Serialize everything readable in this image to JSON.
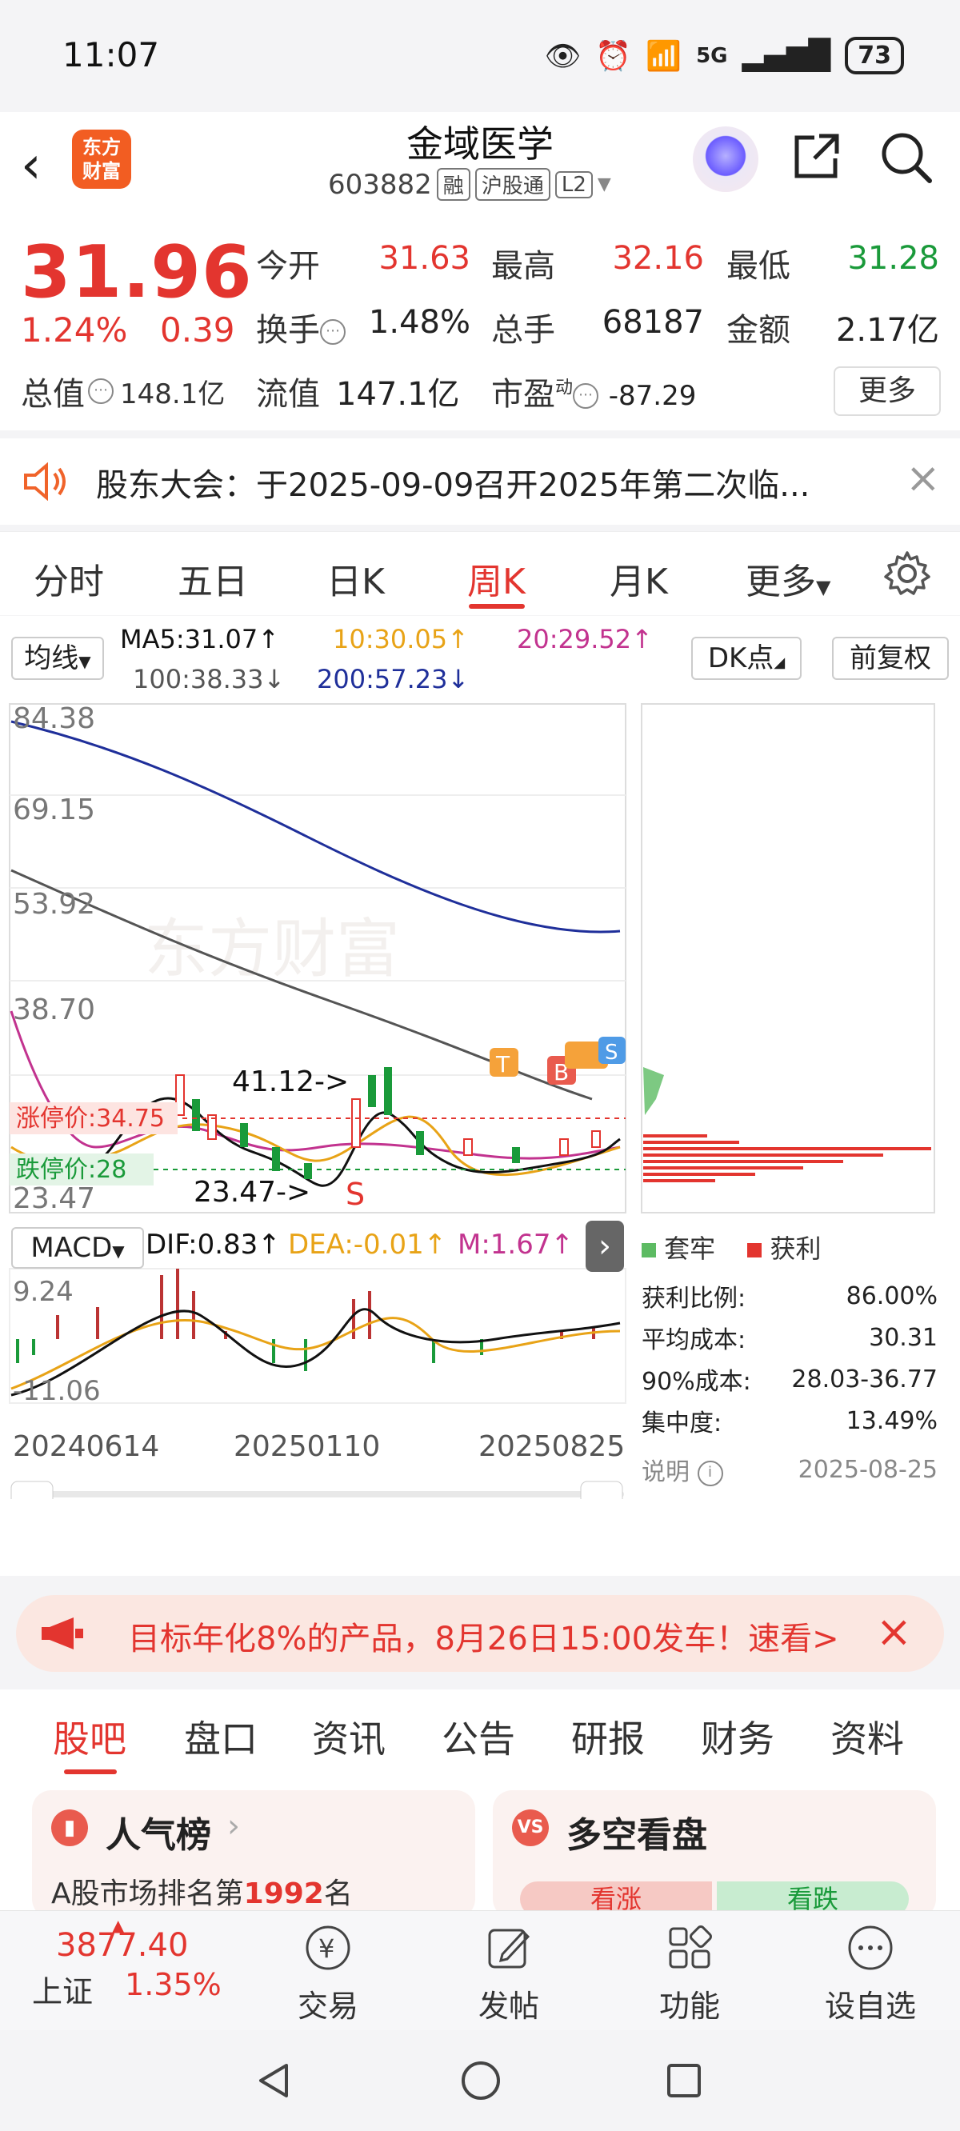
{
  "status": {
    "time": "11:07",
    "battery": "73",
    "network": "5G"
  },
  "header": {
    "logo_line1": "东方",
    "logo_line2": "财富",
    "stock_name": "金域医学",
    "stock_code": "603882",
    "tags": [
      "融",
      "沪股通",
      "L2"
    ]
  },
  "quote": {
    "price": "31.96",
    "change_pct": "1.24%",
    "change_val": "0.39",
    "total_value_label": "总值",
    "total_value": "148.1亿",
    "open_label": "今开",
    "open": "31.63",
    "high_label": "最高",
    "high": "32.16",
    "low_label": "最低",
    "low": "31.28",
    "turnover_label": "换手",
    "turnover": "1.48%",
    "volume_label": "总手",
    "volume": "68187",
    "amount_label": "金额",
    "amount": "2.17亿",
    "float_label": "流值",
    "float_value": "147.1亿",
    "pe_label": "市盈",
    "pe_sup": "动",
    "pe": "-87.29",
    "more": "更多"
  },
  "notice": {
    "text": "股东大会：于2025-09-09召开2025年第二次临..."
  },
  "ktabs": [
    "分时",
    "五日",
    "日K",
    "周K",
    "月K",
    "更多"
  ],
  "ktab_active": "周K",
  "ma": {
    "selector": "均线",
    "ma5": "MA5:31.07↑",
    "ma10": "10:30.05↑",
    "ma20": "20:29.52↑",
    "ma100": "100:38.33↓",
    "ma200": "200:57.23↓",
    "dk": "DK点",
    "fq": "前复权",
    "colors": {
      "ma5": "#111111",
      "ma10": "#e8a317",
      "ma20": "#c2338f",
      "ma100": "#555555",
      "ma200": "#1f2f9a"
    }
  },
  "chart": {
    "y_labels": [
      "84.38",
      "69.15",
      "53.92",
      "38.70",
      "23.47"
    ],
    "limit_up": "涨停价:34.75",
    "limit_down": "跌停价:28",
    "high_mark": "41.12->",
    "low_mark": "23.47->",
    "macd_selector": "MACD",
    "dif": "DIF:0.83↑",
    "dea": "DEA:-0.01↑",
    "m": "M:1.67↑",
    "macd_top": "9.24",
    "macd_bottom": "-11.06",
    "dates": [
      "20240614",
      "20250110",
      "20250825"
    ],
    "watermark": "东方财富",
    "markers": [
      "T",
      "B",
      "S"
    ]
  },
  "chip": {
    "legend_trap": "套牢",
    "legend_profit": "获利",
    "rows": [
      {
        "label": "获利比例:",
        "value": "86.00%"
      },
      {
        "label": "平均成本:",
        "value": "30.31"
      },
      {
        "label": "90%成本:",
        "value": "28.03-36.77"
      },
      {
        "label": "集中度:",
        "value": "13.49%"
      }
    ],
    "note_label": "说明",
    "date": "2025-08-25"
  },
  "promo": {
    "text": "目标年化8%的产品，8月26日15:00发车！速看>"
  },
  "btabs": [
    "股吧",
    "盘口",
    "资讯",
    "公告",
    "研报",
    "财务",
    "资料"
  ],
  "btab_active": "股吧",
  "cards": {
    "left_title": "人气榜",
    "left_sub_prefix": "A股市场排名第",
    "left_rank": "1992",
    "left_sub_suffix": "名",
    "right_title": "多空看盘",
    "right_up": "看涨",
    "right_down": "看跌"
  },
  "bottom_nav": {
    "index_value": "3877.40",
    "index_name": "上证",
    "index_pct": "1.35%",
    "items": [
      "交易",
      "发帖",
      "功能",
      "设自选"
    ]
  }
}
